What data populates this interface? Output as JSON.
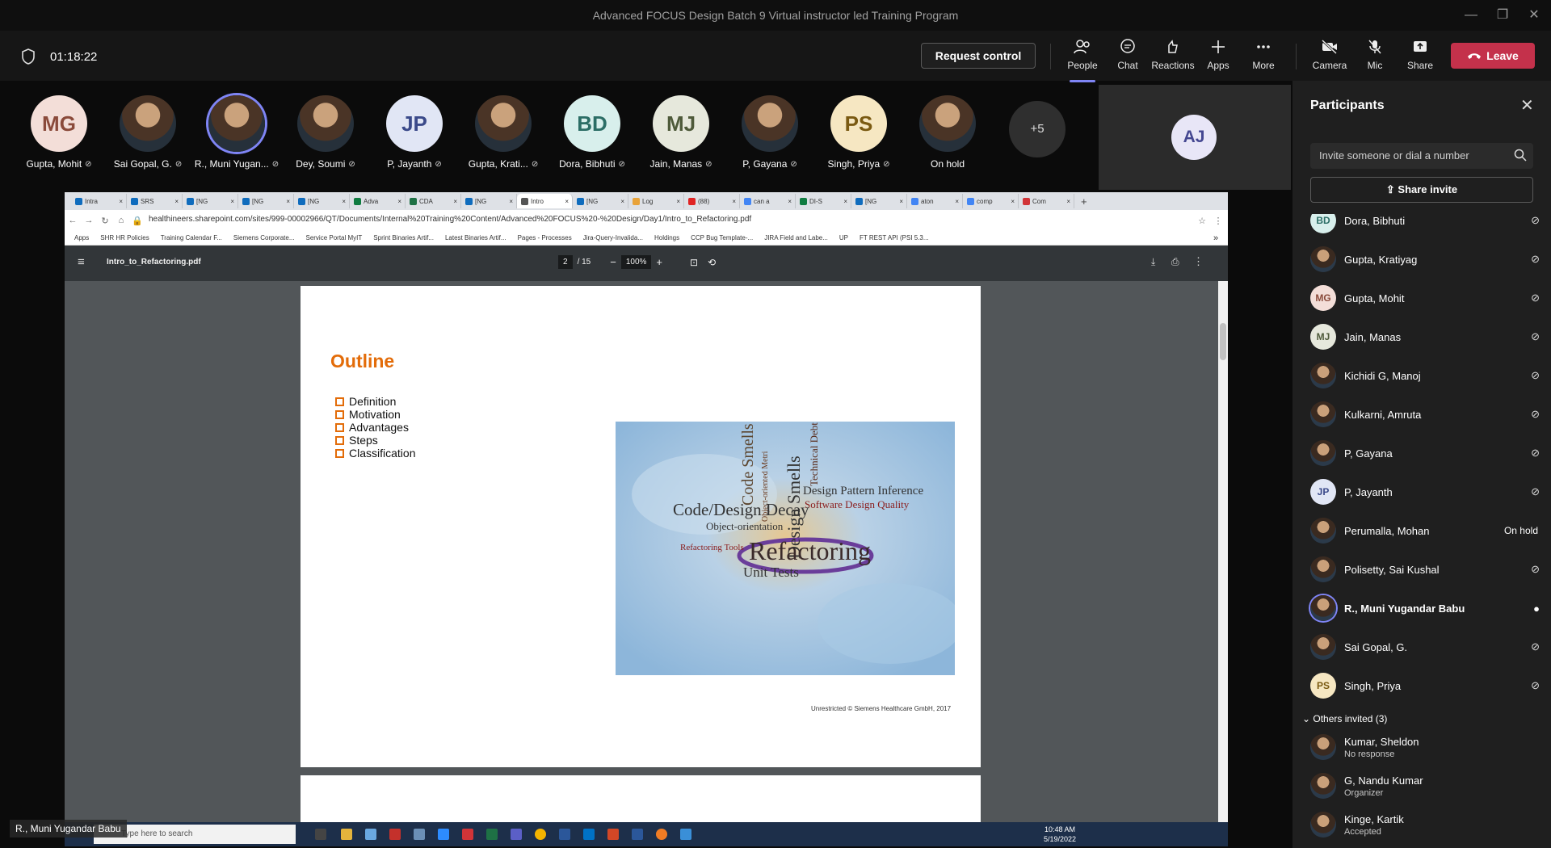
{
  "window": {
    "title": "Advanced FOCUS Design Batch 9 Virtual instructor led Training Program"
  },
  "toolbar": {
    "timer": "01:18:22",
    "request_control": "Request control",
    "buttons": {
      "people": "People",
      "chat": "Chat",
      "reactions": "Reactions",
      "apps": "Apps",
      "more": "More",
      "camera": "Camera",
      "mic": "Mic",
      "share": "Share"
    },
    "leave": "Leave",
    "accent_color": "#7f85f5",
    "leave_color": "#c4314b"
  },
  "gallery": {
    "attendees": [
      {
        "initials": "MG",
        "name": "Gupta, Mohit",
        "bg": "#f3ded8",
        "fg": "#8a4a3a"
      },
      {
        "initials": "",
        "name": "Sai Gopal, G.",
        "photo": true
      },
      {
        "initials": "",
        "name": "R., Muni Yugan...",
        "photo": true,
        "speaking": true
      },
      {
        "initials": "",
        "name": "Dey, Soumi",
        "photo": true
      },
      {
        "initials": "JP",
        "name": "P, Jayanth",
        "bg": "#e1e6f5",
        "fg": "#3b4a8a"
      },
      {
        "initials": "",
        "name": "Gupta, Krati...",
        "photo": true
      },
      {
        "initials": "BD",
        "name": "Dora, Bibhuti",
        "bg": "#d8efec",
        "fg": "#2c6e66"
      },
      {
        "initials": "MJ",
        "name": "Jain, Manas",
        "bg": "#e6e8dc",
        "fg": "#4e5a3a"
      },
      {
        "initials": "",
        "name": "P, Gayana",
        "photo": true
      },
      {
        "initials": "PS",
        "name": "Singh, Priya",
        "bg": "#f6e7c2",
        "fg": "#7a5a12"
      },
      {
        "initials": "",
        "name": "On hold",
        "photo": true
      }
    ],
    "overflow": "+5",
    "self_tile_initials": "AJ"
  },
  "browser": {
    "tabs": [
      "Intra",
      "SRS",
      "[NG",
      "[NG",
      "[NG",
      "Adva",
      "CDA",
      "[NG",
      "Intro",
      "[NG",
      "Log",
      "(88)",
      "can a",
      "DI-S",
      "[NG",
      "aton",
      "comp",
      "Com"
    ],
    "active_tab_index": 8,
    "url": "healthineers.sharepoint.com/sites/999-00002966/QT/Documents/Internal%20Training%20Content/Advanced%20FOCUS%20-%20Design/Day1/Intro_to_Refactoring.pdf",
    "bookmarks": [
      "Apps",
      "SHR HR Policies",
      "Training Calendar F...",
      "Siemens Corporate...",
      "Service Portal MyIT",
      "Sprint Binaries Artif...",
      "Latest Binaries Artif...",
      "Pages - Processes",
      "Jira-Query-Invalida...",
      "Holdings",
      "CCP Bug Template-...",
      "JIRA Field and Labe...",
      "UP",
      "FT REST API (PSI 5.3..."
    ],
    "more_bookmarks": "»"
  },
  "pdf": {
    "filename": "Intro_to_Refactoring.pdf",
    "page_current": "2",
    "page_total": "/ 15",
    "zoom": "100%",
    "slide": {
      "heading": "Outline",
      "bullets": [
        "Definition",
        "Motivation",
        "Advantages",
        "Steps",
        "Classification"
      ],
      "word_cloud": [
        "Code Smells",
        "Object-oriented Metri",
        "Technical Debt",
        "Design Pattern Inference",
        "Software Design Quality",
        "Code/Design Decay",
        "Design Smells",
        "Object-orientation",
        "Refactoring Tools",
        "Refactoring",
        "Unit Tests"
      ],
      "footer": "Unrestricted © Siemens Healthcare GmbH, 2017",
      "heading_color": "#e36c09"
    }
  },
  "taskbar": {
    "search_placeholder": "Type here to search",
    "time": "10:48 AM",
    "date": "5/19/2022"
  },
  "presenter_label": "R., Muni Yugandar Babu",
  "participants": {
    "title": "Participants",
    "invite_placeholder": "Invite someone or dial a number",
    "share_invite": "Share invite",
    "list": [
      {
        "initials": "BD",
        "name": "Dora, Bibhuti",
        "status": "",
        "mic": "off",
        "bg": "#d8efec",
        "fg": "#2c6e66"
      },
      {
        "initials": "",
        "name": "Gupta, Kratiyag",
        "status": "",
        "mic": "off",
        "photo": true
      },
      {
        "initials": "MG",
        "name": "Gupta, Mohit",
        "status": "",
        "mic": "off",
        "bg": "#f3ded8",
        "fg": "#8a4a3a"
      },
      {
        "initials": "MJ",
        "name": "Jain, Manas",
        "status": "",
        "mic": "off",
        "bg": "#e6e8dc",
        "fg": "#4e5a3a"
      },
      {
        "initials": "",
        "name": "Kichidi G, Manoj",
        "status": "",
        "mic": "off",
        "photo": true
      },
      {
        "initials": "",
        "name": "Kulkarni, Amruta",
        "status": "",
        "mic": "off",
        "photo": true
      },
      {
        "initials": "",
        "name": "P, Gayana",
        "status": "",
        "mic": "off",
        "photo": true
      },
      {
        "initials": "JP",
        "name": "P, Jayanth",
        "status": "",
        "mic": "off",
        "bg": "#e1e6f5",
        "fg": "#3b4a8a"
      },
      {
        "initials": "",
        "name": "Perumalla, Mohan",
        "status": "On hold",
        "mic": "",
        "photo": true
      },
      {
        "initials": "",
        "name": "Polisetty, Sai Kushal",
        "status": "",
        "mic": "off",
        "photo": true
      },
      {
        "initials": "",
        "name": "R., Muni Yugandar Babu",
        "status": "",
        "mic": "on",
        "photo": true,
        "bold": true
      },
      {
        "initials": "",
        "name": "Sai Gopal, G.",
        "status": "",
        "mic": "off",
        "photo": true
      },
      {
        "initials": "PS",
        "name": "Singh, Priya",
        "status": "",
        "mic": "off",
        "bg": "#f6e7c2",
        "fg": "#7a5a12"
      }
    ],
    "others_header": "Others invited (3)",
    "others": [
      {
        "name": "Kumar, Sheldon",
        "sub": "No response"
      },
      {
        "name": "G, Nandu Kumar",
        "sub": "Organizer"
      },
      {
        "name": "Kinge, Kartik",
        "sub": "Accepted"
      }
    ]
  }
}
